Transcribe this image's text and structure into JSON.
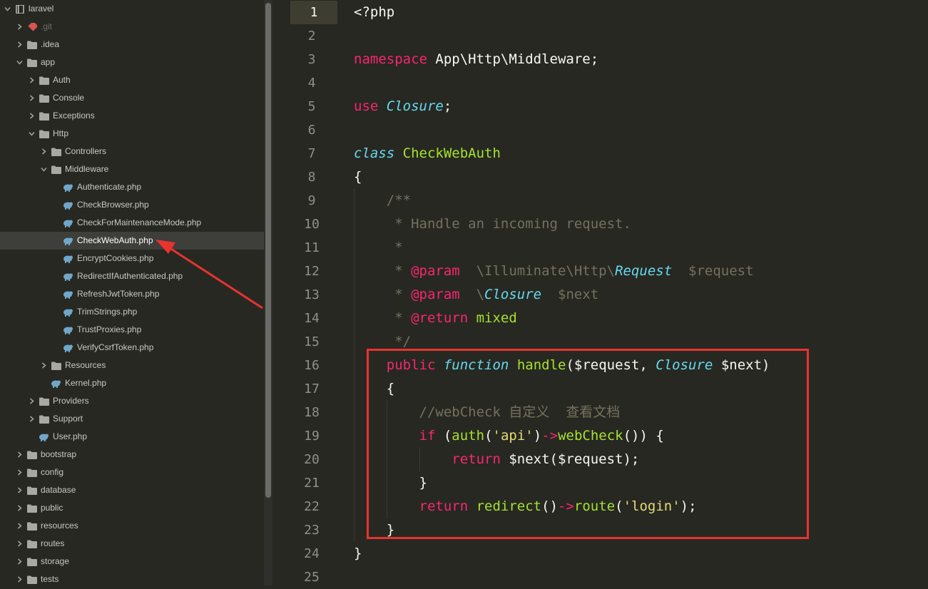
{
  "sidebar": {
    "items": [
      {
        "label": "laravel",
        "depth": 0,
        "kind": "root",
        "arrow": "down"
      },
      {
        "label": ".git",
        "depth": 1,
        "kind": "git",
        "arrow": "right",
        "dim": true
      },
      {
        "label": ".idea",
        "depth": 1,
        "kind": "folder",
        "arrow": "right"
      },
      {
        "label": "app",
        "depth": 1,
        "kind": "folder",
        "arrow": "down"
      },
      {
        "label": "Auth",
        "depth": 2,
        "kind": "folder",
        "arrow": "right"
      },
      {
        "label": "Console",
        "depth": 2,
        "kind": "folder",
        "arrow": "right"
      },
      {
        "label": "Exceptions",
        "depth": 2,
        "kind": "folder",
        "arrow": "right"
      },
      {
        "label": "Http",
        "depth": 2,
        "kind": "folder",
        "arrow": "down"
      },
      {
        "label": "Controllers",
        "depth": 3,
        "kind": "folder",
        "arrow": "right"
      },
      {
        "label": "Middleware",
        "depth": 3,
        "kind": "folder",
        "arrow": "down"
      },
      {
        "label": "Authenticate.php",
        "depth": 4,
        "kind": "php"
      },
      {
        "label": "CheckBrowser.php",
        "depth": 4,
        "kind": "php"
      },
      {
        "label": "CheckForMaintenanceMode.php",
        "depth": 4,
        "kind": "php"
      },
      {
        "label": "CheckWebAuth.php",
        "depth": 4,
        "kind": "php",
        "selected": true
      },
      {
        "label": "EncryptCookies.php",
        "depth": 4,
        "kind": "php"
      },
      {
        "label": "RedirectIfAuthenticated.php",
        "depth": 4,
        "kind": "php"
      },
      {
        "label": "RefreshJwtToken.php",
        "depth": 4,
        "kind": "php"
      },
      {
        "label": "TrimStrings.php",
        "depth": 4,
        "kind": "php"
      },
      {
        "label": "TrustProxies.php",
        "depth": 4,
        "kind": "php"
      },
      {
        "label": "VerifyCsrfToken.php",
        "depth": 4,
        "kind": "php"
      },
      {
        "label": "Resources",
        "depth": 3,
        "kind": "folder",
        "arrow": "right"
      },
      {
        "label": "Kernel.php",
        "depth": 3,
        "kind": "php"
      },
      {
        "label": "Providers",
        "depth": 2,
        "kind": "folder",
        "arrow": "right"
      },
      {
        "label": "Support",
        "depth": 2,
        "kind": "folder",
        "arrow": "right"
      },
      {
        "label": "User.php",
        "depth": 2,
        "kind": "php"
      },
      {
        "label": "bootstrap",
        "depth": 1,
        "kind": "folder",
        "arrow": "right"
      },
      {
        "label": "config",
        "depth": 1,
        "kind": "folder",
        "arrow": "right"
      },
      {
        "label": "database",
        "depth": 1,
        "kind": "folder",
        "arrow": "right"
      },
      {
        "label": "public",
        "depth": 1,
        "kind": "folder",
        "arrow": "right"
      },
      {
        "label": "resources",
        "depth": 1,
        "kind": "folder",
        "arrow": "right"
      },
      {
        "label": "routes",
        "depth": 1,
        "kind": "folder",
        "arrow": "right"
      },
      {
        "label": "storage",
        "depth": 1,
        "kind": "folder",
        "arrow": "right"
      },
      {
        "label": "tests",
        "depth": 1,
        "kind": "folder",
        "arrow": "right"
      }
    ]
  },
  "editor": {
    "active_line": 1,
    "lines": [
      {
        "n": "1",
        "indent": 0,
        "tokens": [
          {
            "t": "<?php",
            "c": "pl"
          }
        ]
      },
      {
        "n": "2",
        "indent": 0,
        "tokens": []
      },
      {
        "n": "3",
        "indent": 0,
        "tokens": [
          {
            "t": "namespace",
            "c": "kw"
          },
          {
            "t": " App\\Http\\Middleware;",
            "c": "pl"
          }
        ]
      },
      {
        "n": "4",
        "indent": 0,
        "tokens": []
      },
      {
        "n": "5",
        "indent": 0,
        "tokens": [
          {
            "t": "use",
            "c": "kw"
          },
          {
            "t": " ",
            "c": "pl"
          },
          {
            "t": "Closure",
            "c": "st"
          },
          {
            "t": ";",
            "c": "pl"
          }
        ]
      },
      {
        "n": "6",
        "indent": 0,
        "tokens": []
      },
      {
        "n": "7",
        "indent": 0,
        "tokens": [
          {
            "t": "class",
            "c": "st"
          },
          {
            "t": " ",
            "c": "pl"
          },
          {
            "t": "CheckWebAuth",
            "c": "fn"
          }
        ]
      },
      {
        "n": "8",
        "indent": 0,
        "tokens": [
          {
            "t": "{",
            "c": "pl"
          }
        ]
      },
      {
        "n": "9",
        "indent": 1,
        "tokens": [
          {
            "t": "/**",
            "c": "cm"
          }
        ]
      },
      {
        "n": "10",
        "indent": 1,
        "tokens": [
          {
            "t": " * Handle an incoming request.",
            "c": "cm"
          }
        ]
      },
      {
        "n": "11",
        "indent": 1,
        "tokens": [
          {
            "t": " *",
            "c": "cm"
          }
        ]
      },
      {
        "n": "12",
        "indent": 1,
        "tokens": [
          {
            "t": " * ",
            "c": "cm"
          },
          {
            "t": "@param",
            "c": "dc"
          },
          {
            "t": "  \\Illuminate\\Http\\",
            "c": "cm"
          },
          {
            "t": "Request",
            "c": "ty"
          },
          {
            "t": "  $request",
            "c": "cm"
          }
        ]
      },
      {
        "n": "13",
        "indent": 1,
        "tokens": [
          {
            "t": " * ",
            "c": "cm"
          },
          {
            "t": "@param",
            "c": "dc"
          },
          {
            "t": "  \\",
            "c": "cm"
          },
          {
            "t": "Closure",
            "c": "ty"
          },
          {
            "t": "  $next",
            "c": "cm"
          }
        ]
      },
      {
        "n": "14",
        "indent": 1,
        "tokens": [
          {
            "t": " * ",
            "c": "cm"
          },
          {
            "t": "@return",
            "c": "dc"
          },
          {
            "t": " ",
            "c": "cm"
          },
          {
            "t": "mixed",
            "c": "mx"
          }
        ]
      },
      {
        "n": "15",
        "indent": 1,
        "tokens": [
          {
            "t": " */",
            "c": "cm"
          }
        ]
      },
      {
        "n": "16",
        "indent": 1,
        "tokens": [
          {
            "t": "public",
            "c": "kw"
          },
          {
            "t": " ",
            "c": "pl"
          },
          {
            "t": "function",
            "c": "st"
          },
          {
            "t": " ",
            "c": "pl"
          },
          {
            "t": "handle",
            "c": "fn"
          },
          {
            "t": "($request, ",
            "c": "pl"
          },
          {
            "t": "Closure",
            "c": "st"
          },
          {
            "t": " $next)",
            "c": "pl"
          }
        ]
      },
      {
        "n": "17",
        "indent": 1,
        "tokens": [
          {
            "t": "{",
            "c": "pl"
          }
        ]
      },
      {
        "n": "18",
        "indent": 2,
        "tokens": [
          {
            "t": "//webCheck 自定义  查看文档",
            "c": "cm"
          }
        ]
      },
      {
        "n": "19",
        "indent": 2,
        "tokens": [
          {
            "t": "if",
            "c": "kw"
          },
          {
            "t": " (",
            "c": "pl"
          },
          {
            "t": "auth",
            "c": "fn"
          },
          {
            "t": "(",
            "c": "pl"
          },
          {
            "t": "'api'",
            "c": "str"
          },
          {
            "t": ")",
            "c": "pl"
          },
          {
            "t": "->",
            "c": "kw"
          },
          {
            "t": "webCheck",
            "c": "fn"
          },
          {
            "t": "()) {",
            "c": "pl"
          }
        ]
      },
      {
        "n": "20",
        "indent": 3,
        "tokens": [
          {
            "t": "return",
            "c": "kw"
          },
          {
            "t": " $next($request);",
            "c": "pl"
          }
        ]
      },
      {
        "n": "21",
        "indent": 2,
        "tokens": [
          {
            "t": "}",
            "c": "pl"
          }
        ]
      },
      {
        "n": "22",
        "indent": 2,
        "tokens": [
          {
            "t": "return",
            "c": "kw"
          },
          {
            "t": " ",
            "c": "pl"
          },
          {
            "t": "redirect",
            "c": "fn"
          },
          {
            "t": "()",
            "c": "pl"
          },
          {
            "t": "->",
            "c": "kw"
          },
          {
            "t": "route",
            "c": "fn"
          },
          {
            "t": "(",
            "c": "pl"
          },
          {
            "t": "'login'",
            "c": "str"
          },
          {
            "t": ");",
            "c": "pl"
          }
        ]
      },
      {
        "n": "23",
        "indent": 1,
        "tokens": [
          {
            "t": "}",
            "c": "pl"
          }
        ]
      },
      {
        "n": "24",
        "indent": 0,
        "tokens": [
          {
            "t": "}",
            "c": "pl"
          }
        ]
      },
      {
        "n": "25",
        "indent": 0,
        "tokens": []
      }
    ]
  },
  "colors": {
    "background": "#272822",
    "keyword": "#f92672",
    "storage": "#66d9ef",
    "function": "#a6e22e",
    "string": "#e6db74",
    "comment": "#75715e",
    "annotation": "#e8332f"
  }
}
